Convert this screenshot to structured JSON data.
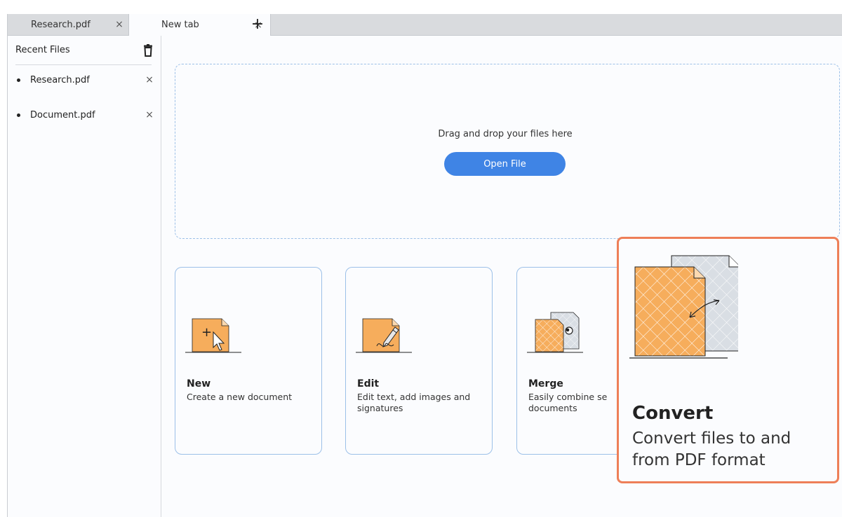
{
  "tabs": [
    {
      "label": "Research.pdf",
      "close": "×"
    },
    {
      "label": "New tab",
      "close": "×"
    }
  ],
  "new_tab": "+",
  "sidebar": {
    "title": "Recent Files",
    "files": [
      {
        "name": "Research.pdf",
        "close": "×"
      },
      {
        "name": "Document.pdf",
        "close": "×"
      }
    ]
  },
  "dropzone": {
    "text": "Drag and drop your files here",
    "button": "Open File"
  },
  "cards": [
    {
      "title": "New",
      "desc": "Create a new document",
      "icon": "new-document-icon"
    },
    {
      "title": "Edit",
      "desc": "Edit text, add images and signatures",
      "icon": "edit-document-icon"
    },
    {
      "title": "Merge",
      "desc": "Easily combine se documents",
      "icon": "merge-documents-icon"
    },
    {
      "title": "Convert",
      "desc": "Convert files to and from PDF format",
      "icon": "convert-documents-icon"
    }
  ],
  "colors": {
    "accent": "#3f84e5",
    "highlight": "#ee7f58",
    "doc_orange": "#f6ad5c",
    "doc_grey": "#d9dee4"
  }
}
